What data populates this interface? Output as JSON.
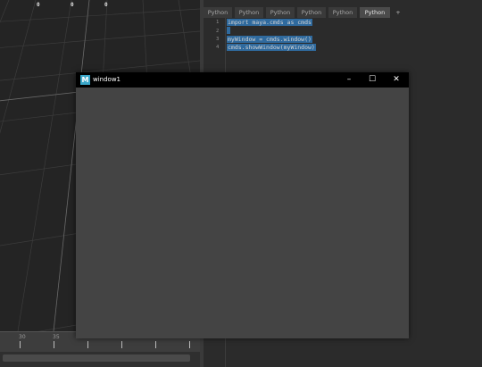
{
  "viewport": {
    "hud_values": [
      "0",
      "0",
      "0"
    ]
  },
  "timeslider": {
    "tick_labels": [
      "30",
      "35"
    ]
  },
  "script_editor": {
    "tabs": [
      "Python",
      "Python",
      "Python",
      "Python",
      "Python",
      "Python"
    ],
    "active_tab_index": 5,
    "add_tab": "+",
    "line_numbers": [
      "1",
      "2",
      "3",
      "4"
    ],
    "code_lines": [
      "import maya.cmds as cmds",
      "",
      "myWindow = cmds.window()",
      "cmds.showWindow(myWindow)"
    ]
  },
  "window": {
    "title": "window1",
    "icon_letter": "M",
    "minimize": "–",
    "maximize": "☐",
    "close": "✕"
  },
  "colors": {
    "selection": "#2f6a9e",
    "window_body": "#444444",
    "titlebar": "#000000",
    "icon": "#3aa7c9"
  }
}
